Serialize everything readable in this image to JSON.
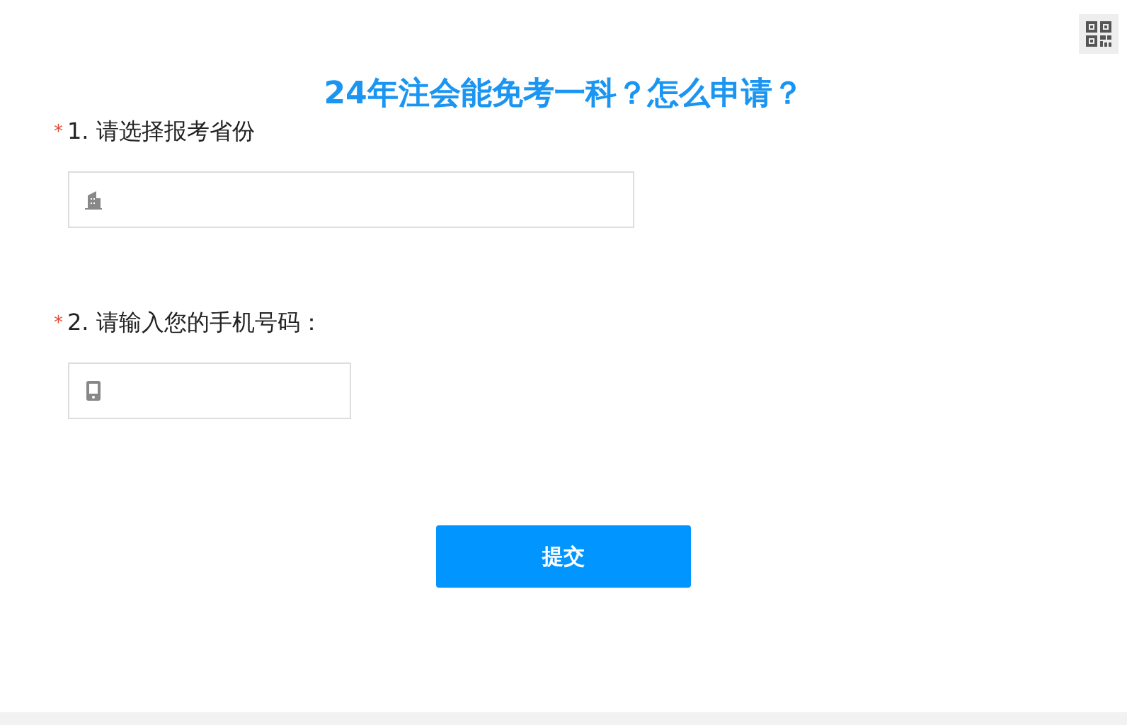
{
  "title": "24年注会能免考一科？怎么申请？",
  "questions": [
    {
      "required_mark": "*",
      "label": "1. 请选择报考省份",
      "kind": "province"
    },
    {
      "required_mark": "*",
      "label": "2. 请输入您的手机号码：",
      "kind": "phone"
    }
  ],
  "submit_button": "提交"
}
